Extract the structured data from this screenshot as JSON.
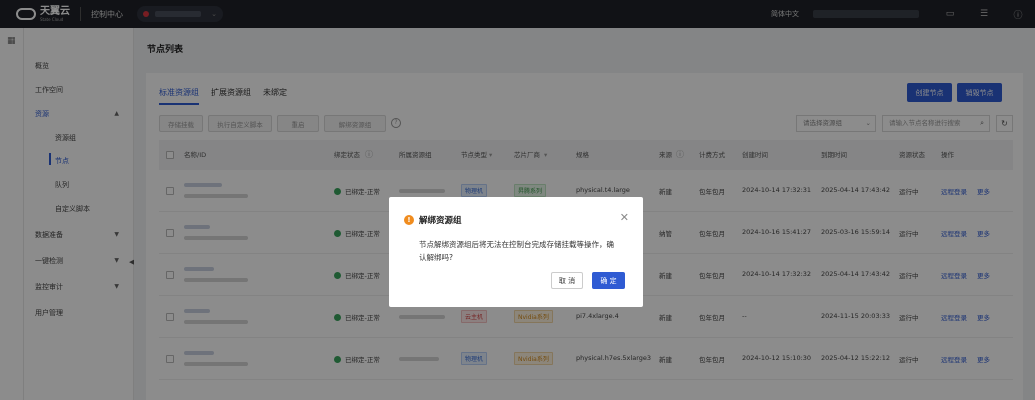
{
  "topbar": {
    "brand": "天翼云",
    "brand_sub": "State Cloud",
    "console": "控制中心",
    "language": "简体中文",
    "icons": [
      "message-icon",
      "settings-icon",
      "help-icon"
    ]
  },
  "sidebar": {
    "items": [
      {
        "label": "概览"
      },
      {
        "label": "工作空间"
      },
      {
        "label": "资源"
      },
      {
        "label": "资源组"
      },
      {
        "label": "节点"
      },
      {
        "label": "队列"
      },
      {
        "label": "自定义脚本"
      },
      {
        "label": "数据准备"
      },
      {
        "label": "一键检测"
      },
      {
        "label": "监控审计"
      },
      {
        "label": "用户管理"
      }
    ]
  },
  "main": {
    "title": "节点列表",
    "tabs": [
      "标准资源组",
      "扩展资源组",
      "未绑定"
    ],
    "create_node": "创建节点",
    "destroy_node": "销毁节点",
    "toolbar": [
      "存储挂载",
      "执行自定义脚本",
      "重启",
      "解绑资源组"
    ],
    "help_mark": "?",
    "select_placeholder": "请选择资源组",
    "search_placeholder": "请输入节点名称进行搜索",
    "columns": [
      "名称/ID",
      "绑定状态",
      "所属资源组",
      "节点类型",
      "芯片厂商",
      "规格",
      "来源",
      "计费方式",
      "创建时间",
      "到期时间",
      "资源状态",
      "操作"
    ],
    "rows": [
      {
        "status": "已绑定-正常",
        "type": "物理机",
        "chip": "昇腾系列",
        "spec": "physical.t4.large",
        "source": "新建",
        "billing": "包年包月",
        "created": "2024-10-14 17:32:31",
        "expires": "2025-04-14 17:43:42",
        "state": "运行中",
        "op1": "远程登录",
        "op2": "更多"
      },
      {
        "status": "已绑定-正常",
        "type": "",
        "chip": "",
        "spec": "",
        "source": "纳管",
        "billing": "包年包月",
        "created": "2024-10-16 15:41:27",
        "expires": "2025-03-16 15:59:14",
        "state": "运行中",
        "op1": "远程登录",
        "op2": "更多"
      },
      {
        "status": "已绑定-正常",
        "type": "",
        "chip": "",
        "spec": "",
        "source": "新建",
        "billing": "包年包月",
        "created": "2024-10-14 17:32:32",
        "expires": "2025-04-14 17:43:42",
        "state": "运行中",
        "op1": "远程登录",
        "op2": "更多"
      },
      {
        "status": "已绑定-正常",
        "type": "云主机",
        "chip": "Nvidia系列",
        "spec": "pi7.4xlarge.4",
        "source": "新建",
        "billing": "包年包月",
        "created": "--",
        "expires": "2024-11-15 20:03:33",
        "state": "运行中",
        "op1": "远程登录",
        "op2": "更多"
      },
      {
        "status": "已绑定-正常",
        "type": "物理机",
        "chip": "Nvidia系列",
        "spec": "physical.h7es.5xlarge3",
        "source": "新建",
        "billing": "包年包月",
        "created": "2024-10-12 15:10:30",
        "expires": "2025-04-12 15:22:12",
        "state": "运行中",
        "op1": "远程登录",
        "op2": "更多"
      }
    ]
  },
  "dialog": {
    "title": "解绑资源组",
    "body": "节点解绑资源组后将无法在控制台完成存储挂载等操作，确认解绑吗?",
    "cancel": "取 消",
    "confirm": "确 定",
    "close_glyph": "✕",
    "warn_glyph": "!"
  }
}
